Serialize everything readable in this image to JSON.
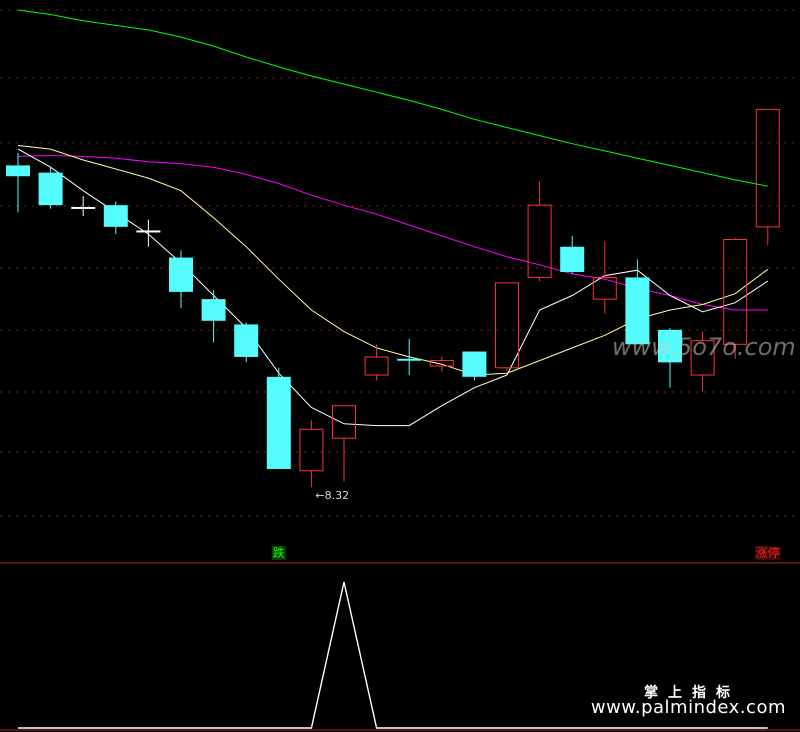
{
  "chart_data": {
    "type": "candlestick",
    "main_pane": {
      "ylim": [
        7.9,
        13.6
      ],
      "grid": true,
      "candles": [
        {
          "open": 11.88,
          "close": 11.76,
          "high": 12.02,
          "low": 11.36
        },
        {
          "open": 11.8,
          "close": 11.44,
          "high": 11.86,
          "low": 11.4
        },
        {
          "open": 11.42,
          "close": 11.42,
          "high": 11.54,
          "low": 11.32
        },
        {
          "open": 11.44,
          "close": 11.2,
          "high": 11.48,
          "low": 11.12
        },
        {
          "open": 11.16,
          "close": 11.16,
          "high": 11.28,
          "low": 10.98
        },
        {
          "open": 10.86,
          "close": 10.48,
          "high": 10.94,
          "low": 10.3
        },
        {
          "open": 10.4,
          "close": 10.16,
          "high": 10.5,
          "low": 9.92
        },
        {
          "open": 10.12,
          "close": 9.76,
          "high": 10.14,
          "low": 9.7
        },
        {
          "open": 9.54,
          "close": 8.52,
          "high": 9.64,
          "low": 8.52
        },
        {
          "open": 8.5,
          "close": 8.96,
          "high": 9.06,
          "low": 8.32
        },
        {
          "open": 8.86,
          "close": 9.22,
          "high": 9.22,
          "low": 8.38
        },
        {
          "open": 9.56,
          "close": 9.76,
          "high": 9.9,
          "low": 9.5
        },
        {
          "open": 9.74,
          "close": 9.74,
          "high": 9.96,
          "low": 9.56
        },
        {
          "open": 9.66,
          "close": 9.72,
          "high": 9.76,
          "low": 9.6
        },
        {
          "open": 9.82,
          "close": 9.54,
          "high": 9.82,
          "low": 9.5
        },
        {
          "open": 9.64,
          "close": 10.58,
          "high": 10.58,
          "low": 9.6
        },
        {
          "open": 10.64,
          "close": 11.44,
          "high": 11.7,
          "low": 10.6
        },
        {
          "open": 10.98,
          "close": 10.7,
          "high": 11.1,
          "low": 10.68
        },
        {
          "open": 10.4,
          "close": 10.64,
          "high": 11.04,
          "low": 10.24
        },
        {
          "open": 10.64,
          "close": 9.9,
          "high": 10.84,
          "low": 9.9
        },
        {
          "open": 10.06,
          "close": 9.7,
          "high": 10.08,
          "low": 9.42
        },
        {
          "open": 9.56,
          "close": 9.94,
          "high": 10.04,
          "low": 9.38
        },
        {
          "open": 9.9,
          "close": 11.06,
          "high": 11.08,
          "low": 9.74
        },
        {
          "open": 11.2,
          "close": 12.5,
          "high": 12.5,
          "low": 11.0
        }
      ],
      "series": [
        {
          "color": "#00ff00",
          "values": [
            13.6,
            13.55,
            13.48,
            13.43,
            13.38,
            13.3,
            13.2,
            13.08,
            12.97,
            12.87,
            12.78,
            12.69,
            12.6,
            12.5,
            12.39,
            12.3,
            12.21,
            12.12,
            12.04,
            11.96,
            11.88,
            11.8,
            11.72,
            11.65
          ]
        },
        {
          "color": "#ff00ff",
          "values": [
            11.98,
            11.99,
            11.98,
            11.96,
            11.92,
            11.9,
            11.86,
            11.78,
            11.68,
            11.55,
            11.44,
            11.34,
            11.22,
            11.1,
            10.98,
            10.87,
            10.78,
            10.68,
            10.62,
            10.52,
            10.44,
            10.34,
            10.28,
            10.28
          ]
        },
        {
          "color": "#ffff99",
          "values": [
            12.1,
            12.06,
            11.94,
            11.84,
            11.74,
            11.6,
            11.3,
            10.98,
            10.62,
            10.28,
            10.04,
            9.86,
            9.76,
            9.68,
            9.56,
            9.58,
            9.72,
            9.86,
            10.0,
            10.18,
            10.28,
            10.34,
            10.46,
            10.73
          ]
        },
        {
          "color": "#ffffff",
          "values": [
            12.06,
            11.86,
            11.6,
            11.36,
            11.12,
            10.8,
            10.44,
            10.08,
            9.58,
            9.2,
            9.02,
            9.0,
            9.0,
            9.22,
            9.42,
            9.56,
            10.28,
            10.44,
            10.66,
            10.72,
            10.44,
            10.26,
            10.36,
            10.6
          ]
        }
      ],
      "annotations": [
        {
          "text": "8.32",
          "at_candle": 9,
          "value": 8.32
        },
        {
          "text": "跌",
          "at_candle": 8,
          "color": "#00ff00"
        },
        {
          "text": "涨停",
          "at_candle": 23,
          "color": "#ff2020"
        }
      ],
      "watermark": "www.5o7o.com"
    },
    "sub_pane": {
      "ylim": [
        0,
        1
      ],
      "series": [
        {
          "color": "#ffffff",
          "values": [
            0,
            0,
            0,
            0,
            0,
            0,
            0,
            0,
            0,
            0,
            1,
            0,
            0,
            0,
            0,
            0,
            0,
            0,
            0,
            0,
            0,
            0,
            0,
            0
          ]
        }
      ]
    },
    "colors": {
      "up": "#ff3232",
      "down": "#54fcfc",
      "grid": "#8b1a1a",
      "background": "#000000"
    }
  },
  "footer": {
    "watermark_title": "掌上指标",
    "watermark_url": "www.palmindex.com"
  }
}
